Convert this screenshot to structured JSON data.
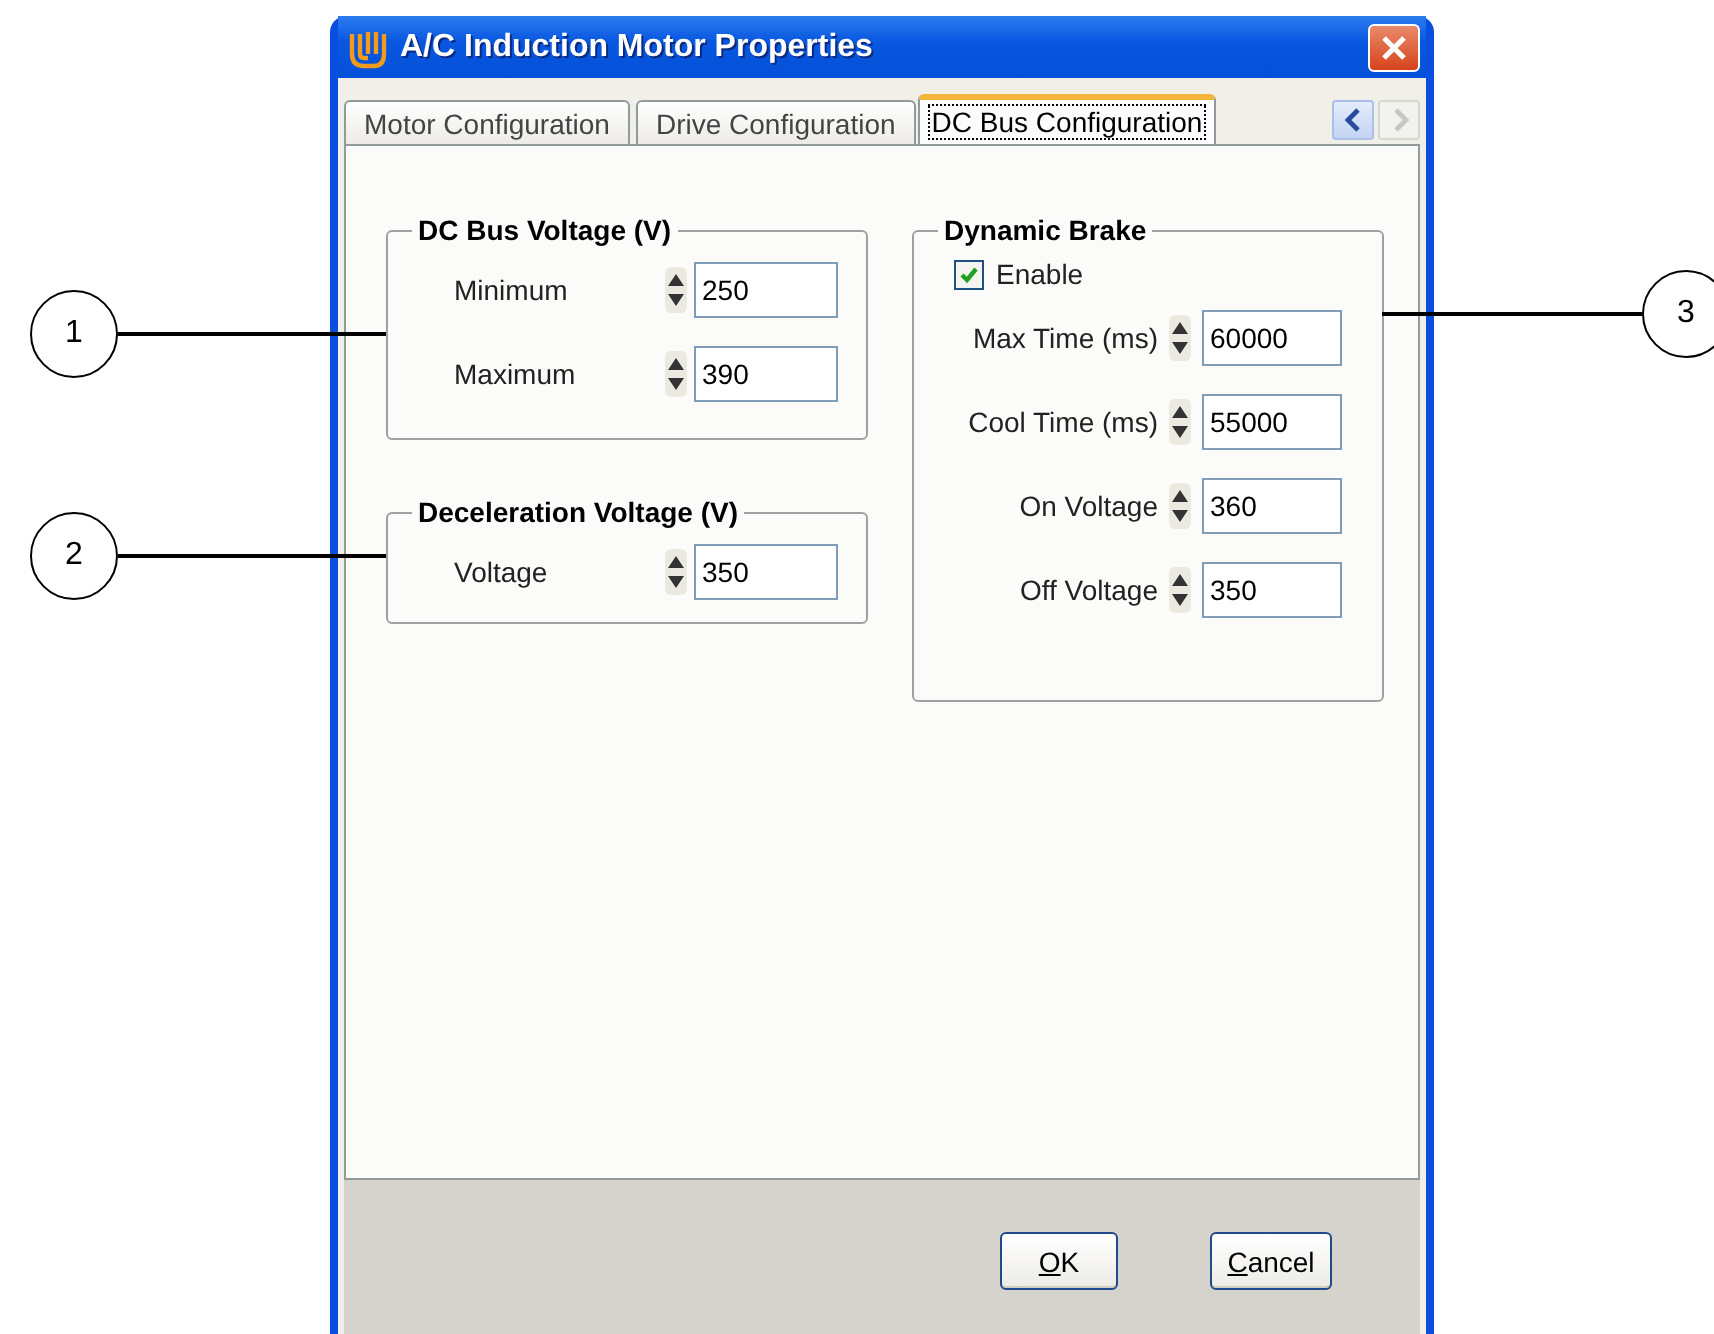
{
  "window": {
    "title": "A/C Induction Motor Properties"
  },
  "tabs": [
    {
      "label": "Motor Configuration",
      "selected": false
    },
    {
      "label": "Drive Configuration",
      "selected": false
    },
    {
      "label": "DC Bus Configuration",
      "selected": true
    }
  ],
  "tab_scroll_buttons": [
    {
      "kind": "left",
      "disabled": false
    },
    {
      "kind": "right",
      "disabled": true
    }
  ],
  "groups": [
    {
      "title": "DC Bus Voltage (V)",
      "fields": [
        {
          "kind": "spin",
          "label": "Minimum",
          "value": "250"
        },
        {
          "kind": "spin",
          "label": "Maximum",
          "value": "390"
        }
      ]
    },
    {
      "title": "Deceleration Voltage (V)",
      "fields": [
        {
          "kind": "spin",
          "label": "Voltage",
          "value": "350"
        }
      ]
    },
    {
      "title": "Dynamic Brake",
      "fields": [
        {
          "kind": "checkbox",
          "label": "Enable",
          "checked": true
        },
        {
          "kind": "spin",
          "label": "Max Time (ms)",
          "value": "60000"
        },
        {
          "kind": "spin",
          "label": "Cool Time (ms)",
          "value": "55000"
        },
        {
          "kind": "spin",
          "label": "On Voltage",
          "value": "360"
        },
        {
          "kind": "spin",
          "label": "Off Voltage",
          "value": "350"
        }
      ]
    }
  ],
  "buttons": [
    {
      "label": "OK"
    },
    {
      "label": "Cancel"
    }
  ],
  "callouts": [
    {
      "number": "1"
    },
    {
      "number": "2"
    },
    {
      "number": "3"
    }
  ]
}
